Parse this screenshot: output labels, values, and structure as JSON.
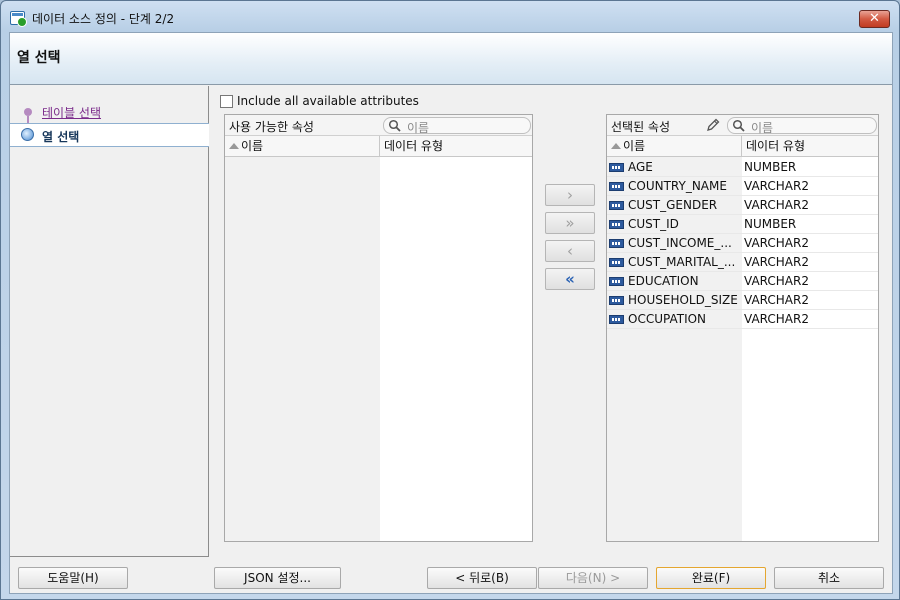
{
  "window": {
    "title": "데이터 소스 정의 - 단계 2/2",
    "close_label": "✕"
  },
  "header": {
    "title": "열 선택"
  },
  "nav": {
    "steps": [
      {
        "label": "테이블 선택"
      },
      {
        "label": "열 선택"
      }
    ]
  },
  "include_all": {
    "label": "Include all available attributes",
    "checked": false
  },
  "available": {
    "label": "사용 가능한 속성",
    "search_placeholder": "이름",
    "columns": [
      "이름",
      "데이터 유형"
    ],
    "rows": []
  },
  "selected": {
    "label": "선택된 속성",
    "search_placeholder": "이름",
    "columns": [
      "이름",
      "데이터 유형"
    ],
    "rows": [
      {
        "name": "AGE",
        "type": "NUMBER"
      },
      {
        "name": "COUNTRY_NAME",
        "type": "VARCHAR2"
      },
      {
        "name": "CUST_GENDER",
        "type": "VARCHAR2"
      },
      {
        "name": "CUST_ID",
        "type": "NUMBER"
      },
      {
        "name": "CUST_INCOME_...",
        "type": "VARCHAR2"
      },
      {
        "name": "CUST_MARITAL_...",
        "type": "VARCHAR2"
      },
      {
        "name": "EDUCATION",
        "type": "VARCHAR2"
      },
      {
        "name": "HOUSEHOLD_SIZE",
        "type": "VARCHAR2"
      },
      {
        "name": "OCCUPATION",
        "type": "VARCHAR2"
      }
    ]
  },
  "shuttle": {
    "move": "›",
    "move_all": "»",
    "remove": "‹",
    "remove_all": "«"
  },
  "footer": {
    "help": "도움말(H)",
    "json": "JSON 설정...",
    "back": "< 뒤로(B)",
    "next": "다음(N) >",
    "finish": "완료(F)",
    "cancel": "취소"
  },
  "colors": {
    "accent": "#2a62b4",
    "visited_link": "#7a2a8a",
    "finish_border": "#e4a630"
  }
}
